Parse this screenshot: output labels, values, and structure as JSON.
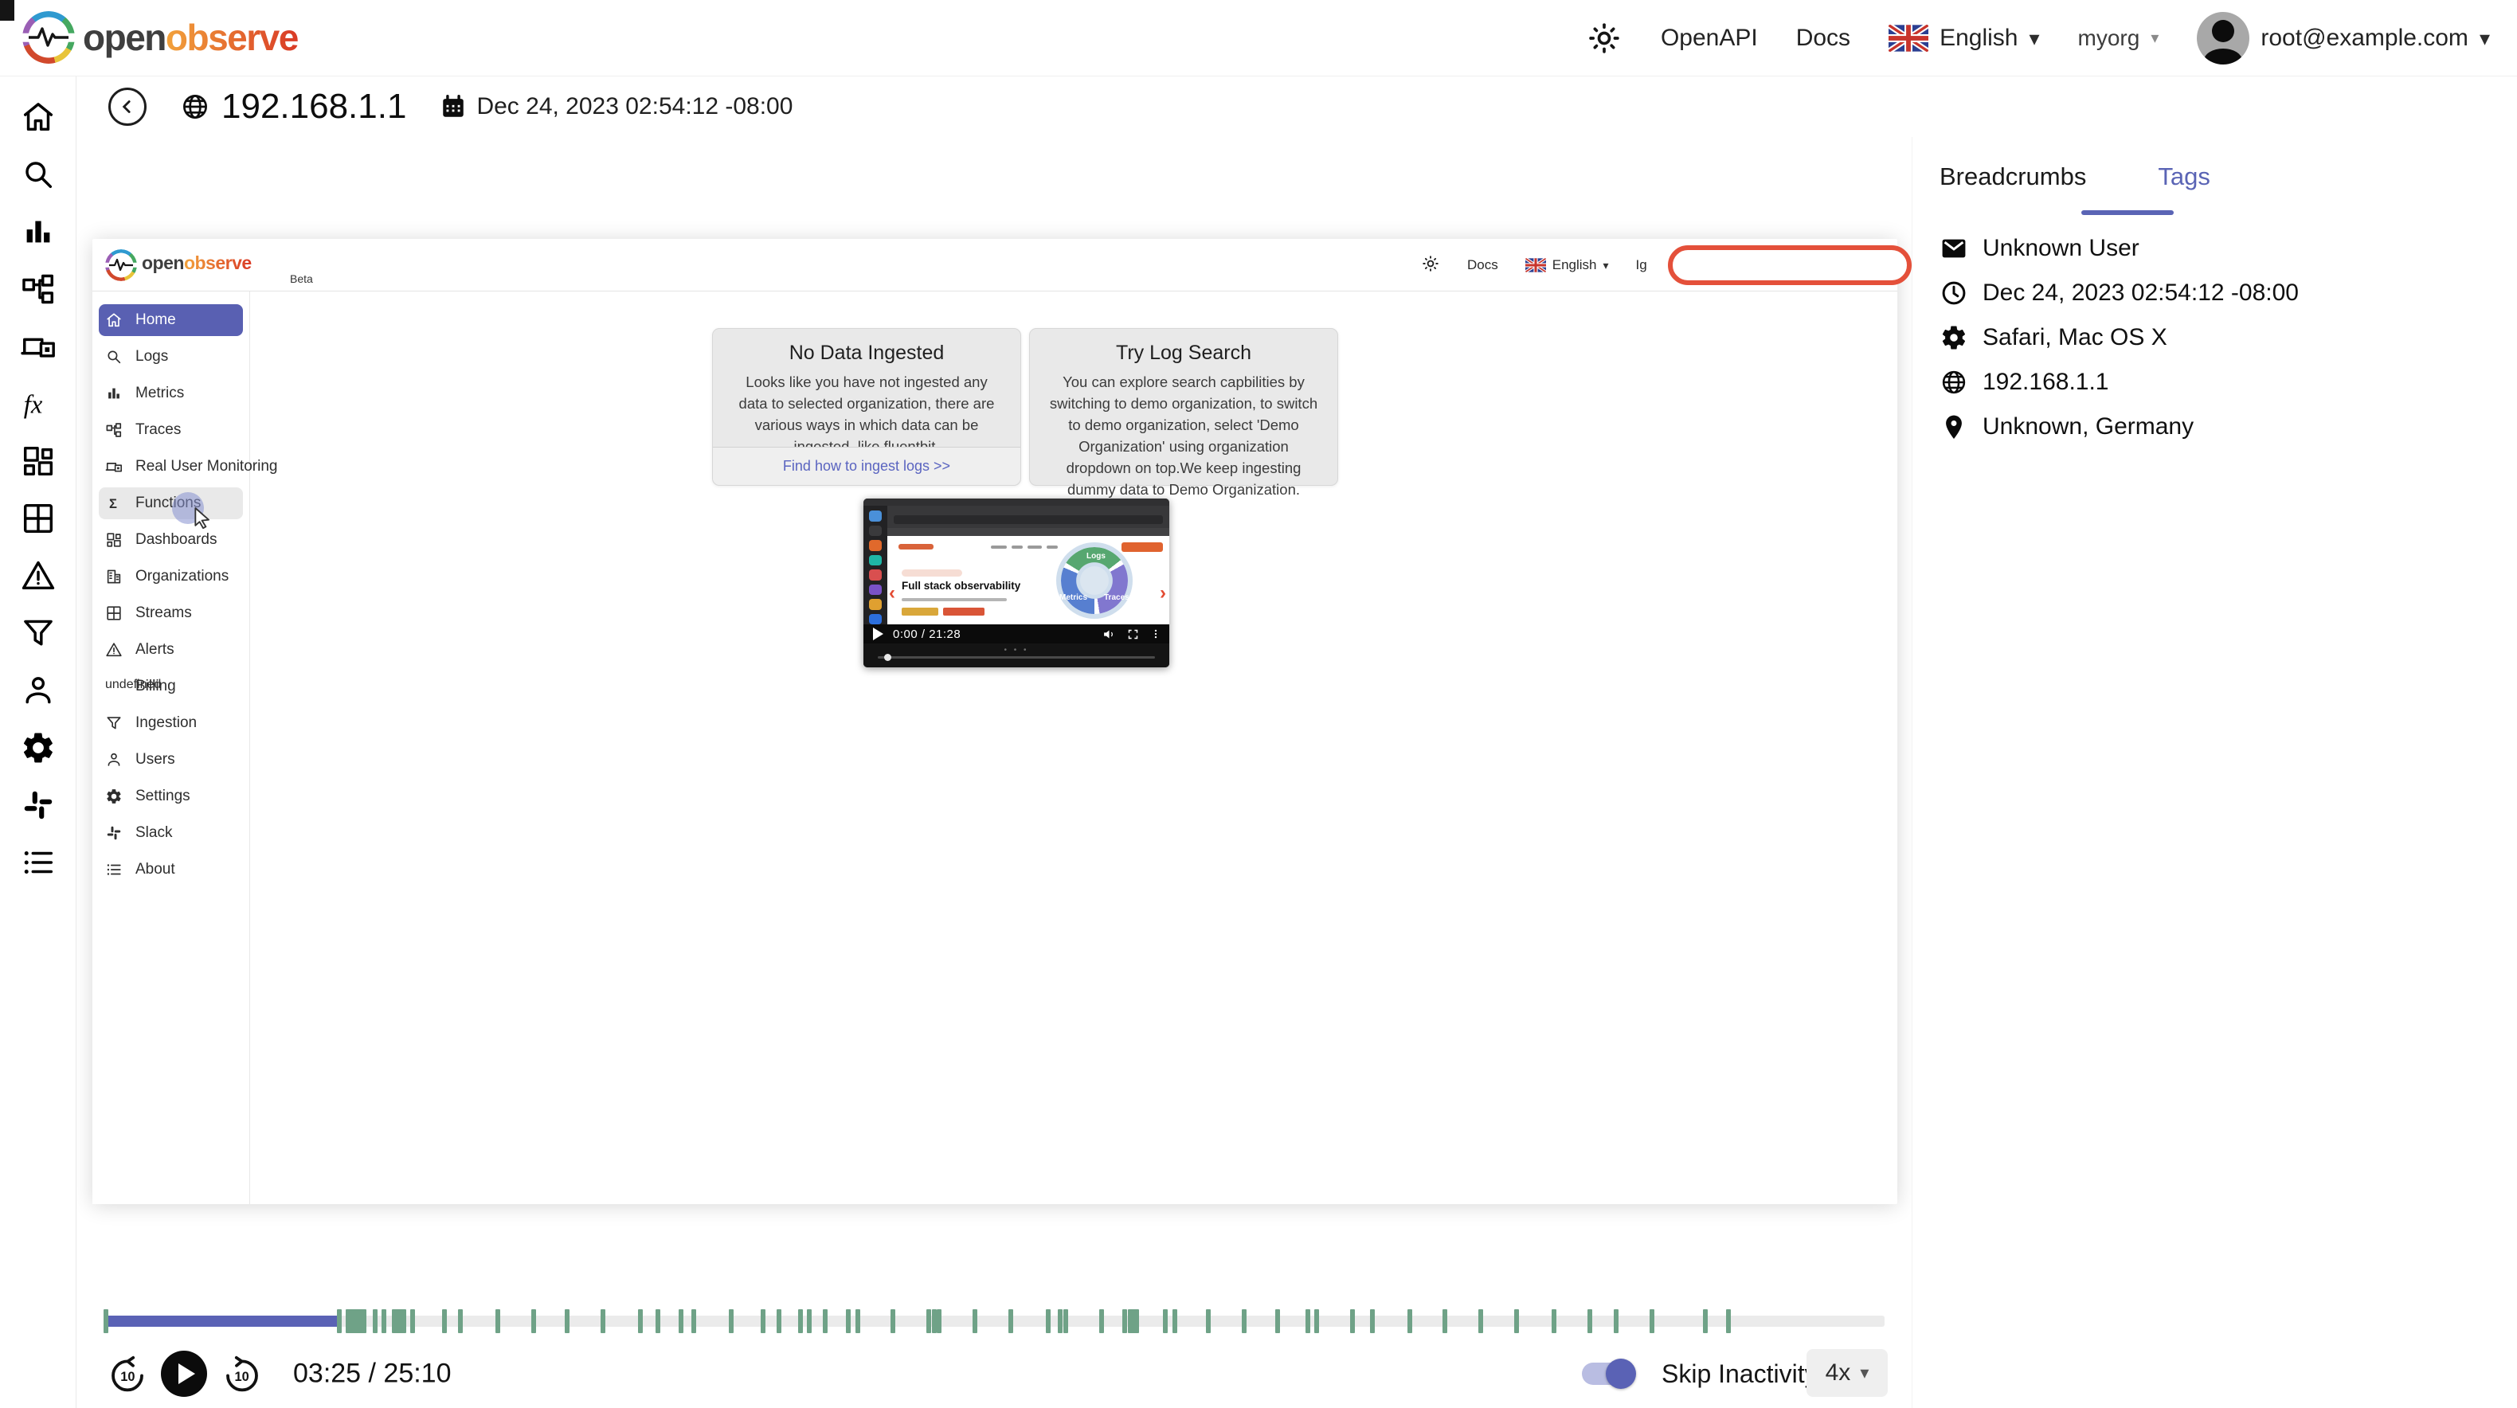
{
  "topbar": {
    "logo_open": "open",
    "logo_observe": "observe",
    "openapi": "OpenAPI",
    "docs": "Docs",
    "language": "English",
    "org": "myorg",
    "email": "root@example.com"
  },
  "session": {
    "ip": "192.168.1.1",
    "timestamp": "Dec 24, 2023 02:54:12 -08:00"
  },
  "rail": [
    "home-icon",
    "search-icon",
    "metrics-icon",
    "traces-icon",
    "rum-icon",
    "fx-icon",
    "dashboards-icon",
    "streams-icon",
    "alerts-icon",
    "ingestion-icon",
    "users-icon",
    "settings-icon",
    "slack-icon",
    "about-icon"
  ],
  "replay": {
    "header": {
      "logo_open": "open",
      "logo_observe": "observe",
      "beta": "Beta",
      "docs": "Docs",
      "language": "English",
      "masked_text": "Ig"
    },
    "sidebar": [
      {
        "label": "Home",
        "icon": "home-icon",
        "state": "active"
      },
      {
        "label": "Logs",
        "icon": "search-icon",
        "state": ""
      },
      {
        "label": "Metrics",
        "icon": "metrics-icon",
        "state": ""
      },
      {
        "label": "Traces",
        "icon": "traces-icon",
        "state": ""
      },
      {
        "label": "Real User Monitoring",
        "icon": "rum-icon",
        "state": ""
      },
      {
        "label": "Functions",
        "icon": "sigma-icon",
        "state": "hover"
      },
      {
        "label": "Dashboards",
        "icon": "dashboards-icon",
        "state": ""
      },
      {
        "label": "Organizations",
        "icon": "orgs-icon",
        "state": ""
      },
      {
        "label": "Streams",
        "icon": "streams-icon",
        "state": ""
      },
      {
        "label": "Alerts",
        "icon": "alerts-icon",
        "state": ""
      },
      {
        "label": "Billing",
        "icon": "billing-icon",
        "state": ""
      },
      {
        "label": "Ingestion",
        "icon": "ingestion-icon",
        "state": ""
      },
      {
        "label": "Users",
        "icon": "users-icon",
        "state": ""
      },
      {
        "label": "Settings",
        "icon": "settings-icon",
        "state": ""
      },
      {
        "label": "Slack",
        "icon": "slack-icon",
        "state": ""
      },
      {
        "label": "About",
        "icon": "about-icon",
        "state": ""
      }
    ],
    "cards": {
      "no_data": {
        "title": "No Data Ingested",
        "body": "Looks like you have not ingested any data to selected organization, there are various ways in which data can be ingested, like fluentbit.",
        "link": "Find how to ingest logs >>"
      },
      "try_log": {
        "title": "Try Log Search",
        "body": "You can explore search capbilities by switching to demo organization, to switch to demo organization, select 'Demo Organization' using organization dropdown on top.We keep ingesting dummy data to Demo Organization."
      }
    },
    "video": {
      "headline": "Full stack observability",
      "time": "0:00 / 21:28",
      "donut_labels": [
        "Logs",
        "Metrics",
        "Traces"
      ]
    }
  },
  "panel": {
    "tabs": [
      "Breadcrumbs",
      "Tags"
    ],
    "active_tab": "Tags",
    "tags": [
      {
        "icon": "mail-icon",
        "text": "Unknown User"
      },
      {
        "icon": "clock-icon",
        "text": "Dec 24, 2023 02:54:12 -08:00"
      },
      {
        "icon": "gear-icon",
        "text": "Safari, Mac OS X"
      },
      {
        "icon": "globe-icon",
        "text": "192.168.1.1"
      },
      {
        "icon": "location-icon",
        "text": "Unknown, Germany"
      }
    ]
  },
  "player": {
    "time": "03:25 / 25:10",
    "skip_label": "Skip Inactivity",
    "speed": "4x",
    "progress_pct": 13.1,
    "markers": [
      [
        0,
        6
      ],
      [
        13.1,
        6
      ],
      [
        13.6,
        26
      ],
      [
        15.1,
        6
      ],
      [
        15.6,
        6
      ],
      [
        16.2,
        18
      ],
      [
        17.2,
        6
      ],
      [
        19,
        6
      ],
      [
        19.9,
        6
      ],
      [
        22,
        6
      ],
      [
        24,
        6
      ],
      [
        25.9,
        6
      ],
      [
        27.9,
        6
      ],
      [
        30,
        6
      ],
      [
        31,
        6
      ],
      [
        32.3,
        6
      ],
      [
        33,
        6
      ],
      [
        35.1,
        6
      ],
      [
        36.9,
        6
      ],
      [
        37.8,
        6
      ],
      [
        39,
        6
      ],
      [
        39.5,
        6
      ],
      [
        40.4,
        6
      ],
      [
        41.7,
        6
      ],
      [
        42.2,
        6
      ],
      [
        44.2,
        6
      ],
      [
        46.2,
        6
      ],
      [
        46.5,
        6
      ],
      [
        46.8,
        6
      ],
      [
        48.8,
        6
      ],
      [
        50.8,
        6
      ],
      [
        52.9,
        6
      ],
      [
        53.6,
        6
      ],
      [
        53.9,
        6
      ],
      [
        55.9,
        6
      ],
      [
        57.2,
        6
      ],
      [
        57.5,
        14
      ],
      [
        59.5,
        6
      ],
      [
        60,
        6
      ],
      [
        61.9,
        6
      ],
      [
        63.9,
        6
      ],
      [
        65.8,
        6
      ],
      [
        67.5,
        6
      ],
      [
        68,
        6
      ],
      [
        70,
        6
      ],
      [
        71.1,
        6
      ],
      [
        73.2,
        6
      ],
      [
        75.2,
        6
      ],
      [
        77.2,
        6
      ],
      [
        79.2,
        6
      ],
      [
        81.3,
        6
      ],
      [
        83.3,
        6
      ],
      [
        84.8,
        6
      ],
      [
        86.8,
        6
      ],
      [
        89.8,
        6
      ],
      [
        91.1,
        6
      ]
    ]
  },
  "colors": {
    "accent": "#5a62b5",
    "marker_green": "#6fa287",
    "highlight_red": "#e4503a",
    "link": "#5a64c0"
  }
}
